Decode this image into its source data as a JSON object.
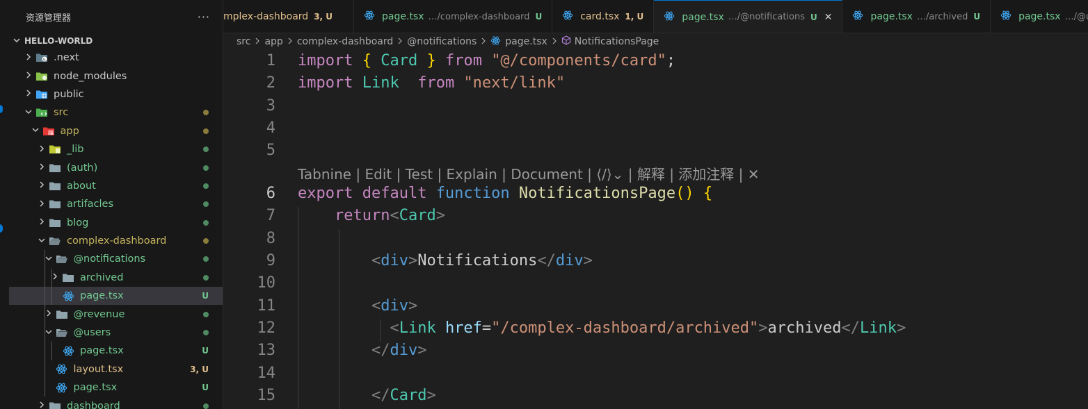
{
  "explorer": {
    "title": "资源管理器",
    "more": "···",
    "project": "HELLO-WORLD",
    "items": [
      {
        "label": ".next",
        "depth": 0,
        "expanded": false,
        "icon": "next-folder-icon",
        "color": "#cccccc",
        "badge": "",
        "bullet": ""
      },
      {
        "label": "node_modules",
        "depth": 0,
        "expanded": false,
        "icon": "node-folder-icon",
        "color": "#cccccc",
        "badge": "",
        "bullet": ""
      },
      {
        "label": "public",
        "depth": 0,
        "expanded": false,
        "icon": "globe-folder-icon",
        "color": "#cccccc",
        "badge": "",
        "bullet": ""
      },
      {
        "label": "src",
        "depth": 0,
        "expanded": true,
        "icon": "src-folder-icon",
        "color": "#c5b45e",
        "badge": "",
        "bullet": "#8c7c3b"
      },
      {
        "label": "app",
        "depth": 1,
        "expanded": true,
        "icon": "app-folder-icon",
        "color": "#c5b45e",
        "badge": "",
        "bullet": "#8c7c3b"
      },
      {
        "label": "_lib",
        "depth": 2,
        "expanded": false,
        "icon": "lib-folder-icon",
        "color": "#73c991",
        "badge": "",
        "bullet": "#4f8a61"
      },
      {
        "label": "(auth)",
        "depth": 2,
        "expanded": false,
        "icon": "folder-icon",
        "color": "#73c991",
        "badge": "",
        "bullet": "#4f8a61"
      },
      {
        "label": "about",
        "depth": 2,
        "expanded": false,
        "icon": "folder-icon",
        "color": "#73c991",
        "badge": "",
        "bullet": "#4f8a61"
      },
      {
        "label": "artifacles",
        "depth": 2,
        "expanded": false,
        "icon": "folder-icon",
        "color": "#73c991",
        "badge": "",
        "bullet": "#4f8a61"
      },
      {
        "label": "blog",
        "depth": 2,
        "expanded": false,
        "icon": "folder-icon",
        "color": "#73c991",
        "badge": "",
        "bullet": "#4f8a61"
      },
      {
        "label": "complex-dashboard",
        "depth": 2,
        "expanded": true,
        "icon": "folder-open-icon",
        "color": "#c5b45e",
        "badge": "",
        "bullet": "#8c7c3b"
      },
      {
        "label": "@notifications",
        "depth": 3,
        "expanded": true,
        "icon": "folder-open-icon",
        "color": "#73c991",
        "badge": "",
        "bullet": "#4f8a61"
      },
      {
        "label": "archived",
        "depth": 4,
        "expanded": false,
        "icon": "folder-icon",
        "color": "#73c991",
        "badge": "",
        "bullet": "#4f8a61"
      },
      {
        "label": "page.tsx",
        "depth": 4,
        "expanded": null,
        "icon": "react-icon",
        "color": "#73c991",
        "badge": "U",
        "bullet": "",
        "selected": true
      },
      {
        "label": "@revenue",
        "depth": 3,
        "expanded": false,
        "icon": "folder-icon",
        "color": "#73c991",
        "badge": "",
        "bullet": "#4f8a61"
      },
      {
        "label": "@users",
        "depth": 3,
        "expanded": true,
        "icon": "folder-open-icon",
        "color": "#73c991",
        "badge": "",
        "bullet": "#4f8a61"
      },
      {
        "label": "page.tsx",
        "depth": 4,
        "expanded": null,
        "icon": "react-icon",
        "color": "#73c991",
        "badge": "U",
        "bullet": ""
      },
      {
        "label": "layout.tsx",
        "depth": 3,
        "expanded": null,
        "icon": "react-icon",
        "color": "#e2c08d",
        "badge": "3, U",
        "bullet": ""
      },
      {
        "label": "page.tsx",
        "depth": 3,
        "expanded": null,
        "icon": "react-icon",
        "color": "#73c991",
        "badge": "U",
        "bullet": ""
      },
      {
        "label": "dashboard",
        "depth": 2,
        "expanded": false,
        "icon": "folder-icon",
        "color": "#73c991",
        "badge": "",
        "bullet": "#4f8a61"
      }
    ]
  },
  "tabs": [
    {
      "name": "mplex-dashboard",
      "desc": "",
      "status": "3, U",
      "name_color": "#e2c08d",
      "status_color": "#e2c08d",
      "active": false,
      "icon": false,
      "close": ""
    },
    {
      "name": "page.tsx",
      "desc": "…/complex-dashboard",
      "status": "U",
      "name_color": "#73c991",
      "status_color": "#73c991",
      "active": false,
      "icon": true,
      "close": ""
    },
    {
      "name": "card.tsx",
      "desc": "",
      "status": "1, U",
      "name_color": "#e2c08d",
      "status_color": "#e2c08d",
      "active": false,
      "icon": true,
      "close": ""
    },
    {
      "name": "page.tsx",
      "desc": "…/@notifications",
      "status": "U",
      "name_color": "#73c991",
      "status_color": "#73c991",
      "active": true,
      "icon": true,
      "close": "✕"
    },
    {
      "name": "page.tsx",
      "desc": "…/archived",
      "status": "U",
      "name_color": "#73c991",
      "status_color": "#73c991",
      "active": false,
      "icon": true,
      "close": ""
    },
    {
      "name": "page.tsx",
      "desc": "…/@users",
      "status": "U",
      "name_color": "#73c991",
      "status_color": "#73c991",
      "active": false,
      "icon": true,
      "close": ""
    }
  ],
  "breadcrumbs": [
    "src",
    "app",
    "complex-dashboard",
    "@notifications",
    "page.tsx",
    "NotificationsPage"
  ],
  "code": {
    "line_numbers": [
      "1",
      "2",
      "3",
      "4",
      "5",
      "6",
      "7",
      "8",
      "9",
      "10",
      "11",
      "12",
      "13",
      "14",
      "15"
    ],
    "current_line": "6",
    "codelens": "Tabnine | Edit | Test | Explain | Document | ⟨/⟩⌄ | 解释 | 添加注释 | ✕",
    "lines": [
      [
        {
          "t": "import ",
          "c": "kw"
        },
        {
          "t": "{ ",
          "c": "br"
        },
        {
          "t": "Card",
          "c": "ty"
        },
        {
          "t": " } ",
          "c": "br"
        },
        {
          "t": "from ",
          "c": "kw"
        },
        {
          "t": "\"@/components/card\"",
          "c": "st2"
        },
        {
          "t": ";",
          "c": ""
        }
      ],
      [
        {
          "t": "import ",
          "c": "kw"
        },
        {
          "t": "Link  ",
          "c": "ty"
        },
        {
          "t": "from ",
          "c": "kw"
        },
        {
          "t": "\"next/link\"",
          "c": "st2"
        }
      ],
      [],
      [],
      [],
      [
        {
          "t": "export ",
          "c": "kw"
        },
        {
          "t": "default ",
          "c": "kw"
        },
        {
          "t": "function ",
          "c": "dfn"
        },
        {
          "t": "NotificationsPage",
          "c": "fn"
        },
        {
          "t": "() ",
          "c": "br"
        },
        {
          "t": "{",
          "c": "br"
        }
      ],
      [
        {
          "t": "    return",
          "c": "kw"
        },
        {
          "t": "<",
          "c": "pt"
        },
        {
          "t": "Card",
          "c": "ty"
        },
        {
          "t": ">",
          "c": "pt"
        }
      ],
      [],
      [
        {
          "t": "        <",
          "c": "pt"
        },
        {
          "t": "div",
          "c": "tg"
        },
        {
          "t": ">",
          "c": "pt"
        },
        {
          "t": "Notifications",
          "c": ""
        },
        {
          "t": "</",
          "c": "pt"
        },
        {
          "t": "div",
          "c": "tg"
        },
        {
          "t": ">",
          "c": "pt"
        }
      ],
      [],
      [
        {
          "t": "        <",
          "c": "pt"
        },
        {
          "t": "div",
          "c": "tg"
        },
        {
          "t": ">",
          "c": "pt"
        }
      ],
      [
        {
          "t": "          <",
          "c": "pt"
        },
        {
          "t": "Link ",
          "c": "ty"
        },
        {
          "t": "href",
          "c": "vr"
        },
        {
          "t": "=",
          "c": ""
        },
        {
          "t": "\"/complex-dashboard/archived\"",
          "c": "st2"
        },
        {
          "t": ">",
          "c": "pt"
        },
        {
          "t": "archived",
          "c": ""
        },
        {
          "t": "</",
          "c": "pt"
        },
        {
          "t": "Link",
          "c": "ty"
        },
        {
          "t": ">",
          "c": "pt"
        }
      ],
      [
        {
          "t": "        </",
          "c": "pt"
        },
        {
          "t": "div",
          "c": "tg"
        },
        {
          "t": ">",
          "c": "pt"
        }
      ],
      [],
      [
        {
          "t": "        </",
          "c": "pt"
        },
        {
          "t": "Card",
          "c": "ty"
        },
        {
          "t": ">",
          "c": "pt"
        }
      ]
    ]
  },
  "colors": {
    "accent": "#0078d4",
    "untracked": "#73c991",
    "modified": "#e2c08d"
  }
}
